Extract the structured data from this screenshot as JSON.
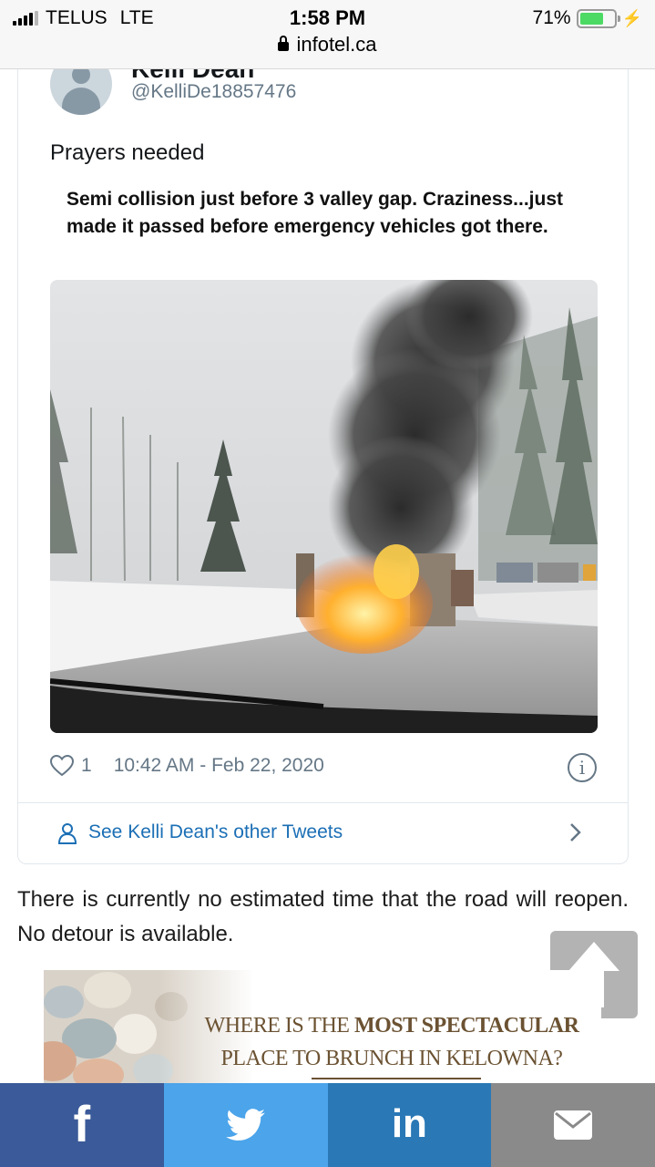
{
  "status_bar": {
    "carrier": "TELUS",
    "network": "LTE",
    "time": "1:58 PM",
    "battery_percent": "71%",
    "battery_level": 0.71,
    "url": "infotel.ca"
  },
  "tweet": {
    "author_name": "Kelli Dean",
    "handle": "@KelliDe18857476",
    "text": "Prayers needed",
    "embedded_caption": "Semi collision just before 3 valley gap. Craziness...just made it passed before emergency vehicles got there.",
    "likes": "1",
    "timestamp": "10:42 AM - Feb 22, 2020",
    "info_glyph": "i",
    "see_more": "See Kelli Dean's other Tweets"
  },
  "article": {
    "paragraph": "There is currently no estimated time that the road will reopen. No detour is available."
  },
  "ad": {
    "line1_a": "WHERE IS THE ",
    "line1_b": "MOST SPECTACULAR",
    "line2": "PLACE TO BRUNCH IN KELOWNA?"
  },
  "share": {
    "facebook_glyph": "f",
    "linkedin_glyph": "in"
  },
  "colors": {
    "facebook": "#3b5a99",
    "twitter": "#4ca4ea",
    "linkedin": "#2a78b6",
    "email": "#8a8a8a",
    "link": "#1b6fb5"
  },
  "icons": [
    "signal-icon",
    "lock-icon",
    "battery-icon",
    "charging-icon",
    "avatar",
    "heart-icon",
    "info-icon",
    "person-icon",
    "chevron-right-icon",
    "arrow-up-icon",
    "twitter-bird-icon",
    "envelope-icon"
  ]
}
